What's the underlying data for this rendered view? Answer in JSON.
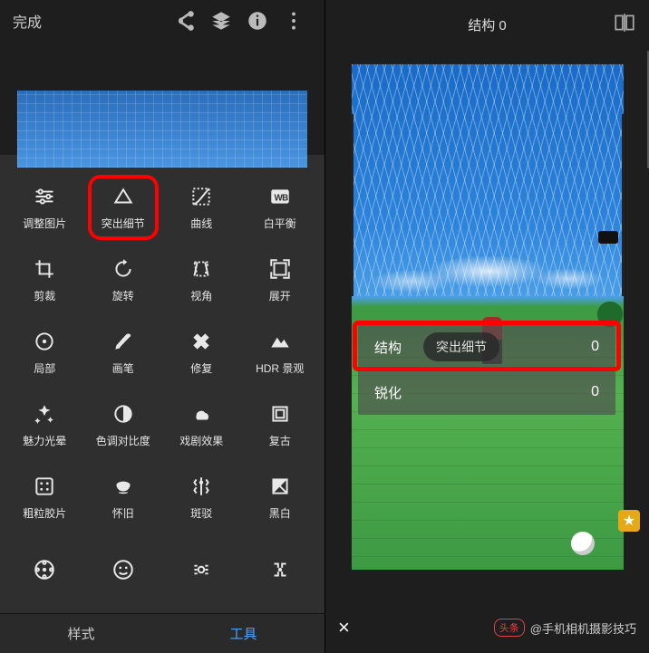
{
  "left": {
    "done": "完成",
    "tabs": {
      "styles": "样式",
      "tools": "工具"
    },
    "tools": [
      {
        "id": "tune",
        "label": "调整图片"
      },
      {
        "id": "details",
        "label": "突出细节"
      },
      {
        "id": "curves",
        "label": "曲线"
      },
      {
        "id": "wb",
        "label": "白平衡"
      },
      {
        "id": "crop",
        "label": "剪裁"
      },
      {
        "id": "rotate",
        "label": "旋转"
      },
      {
        "id": "perspective",
        "label": "视角"
      },
      {
        "id": "expand",
        "label": "展开"
      },
      {
        "id": "selective",
        "label": "局部"
      },
      {
        "id": "brush",
        "label": "画笔"
      },
      {
        "id": "heal",
        "label": "修复"
      },
      {
        "id": "hdr",
        "label": "HDR 景观"
      },
      {
        "id": "glamour",
        "label": "魅力光晕"
      },
      {
        "id": "tonal",
        "label": "色调对比度"
      },
      {
        "id": "drama",
        "label": "戏剧效果"
      },
      {
        "id": "vintage",
        "label": "复古"
      },
      {
        "id": "grainy",
        "label": "粗粒胶片"
      },
      {
        "id": "retro",
        "label": "怀旧"
      },
      {
        "id": "grunge",
        "label": "斑驳"
      },
      {
        "id": "bw",
        "label": "黑白"
      }
    ]
  },
  "right": {
    "title_label": "结构",
    "title_value": "0",
    "overlay": {
      "row1": {
        "label": "结构",
        "pill": "突出细节",
        "value": "0"
      },
      "row2": {
        "label": "锐化",
        "value": "0"
      }
    },
    "close": "×",
    "watermark_prefix": "头条",
    "watermark_account": "@手机相机摄影技巧"
  }
}
